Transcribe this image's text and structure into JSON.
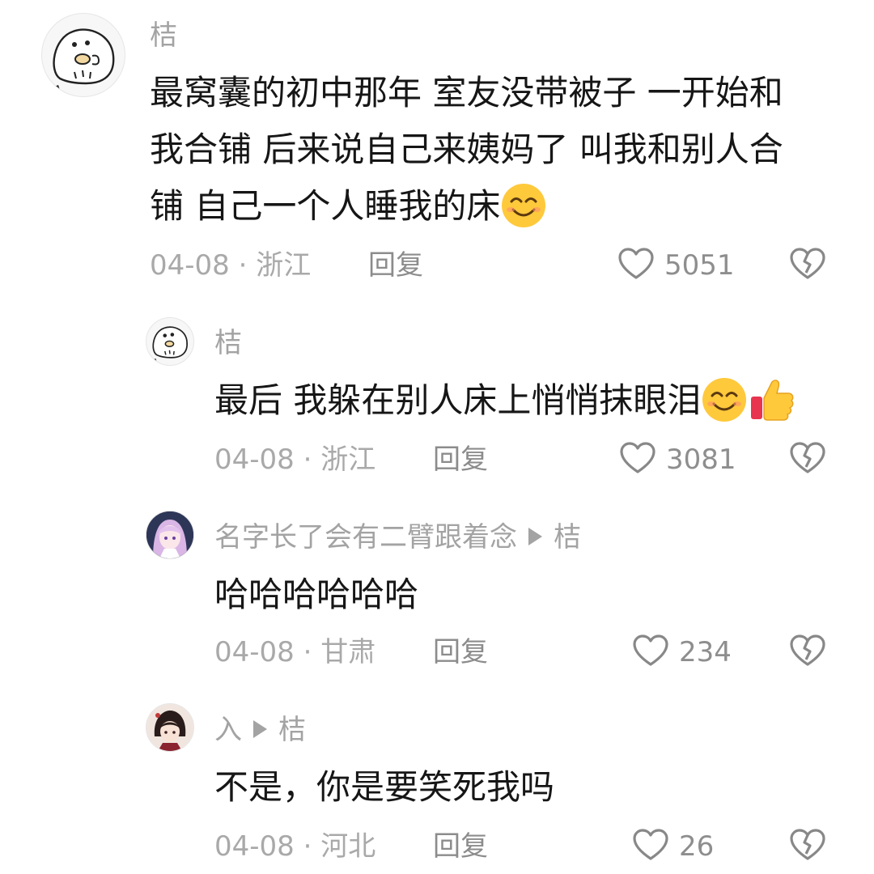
{
  "comments": [
    {
      "user": "桔",
      "lines": [
        "最窝囊的初中那年 室友没带被子 一开始和",
        "我合铺 后来说自己来姨妈了 叫我和别人合",
        "铺 自己一个人睡我的床"
      ],
      "date": "04-08",
      "location": "浙江",
      "reply_label": "回复",
      "likes": "5051"
    },
    {
      "user": "桔",
      "text": "最后 我躲在别人床上悄悄抹眼泪",
      "date": "04-08",
      "location": "浙江",
      "reply_label": "回复",
      "likes": "3081"
    },
    {
      "user": "名字长了会有二臂跟着念",
      "reply_to": "桔",
      "text": "哈哈哈哈哈哈",
      "date": "04-08",
      "location": "甘肃",
      "reply_label": "回复",
      "likes": "234"
    },
    {
      "user": "入",
      "reply_to": "桔",
      "text": "不是，你是要笑死我吗",
      "date": "04-08",
      "location": "河北",
      "reply_label": "回复",
      "likes": "26"
    }
  ],
  "separator": "·",
  "icons": {
    "like": "heart-outline-icon",
    "dislike": "broken-heart-icon",
    "smile": "smiling-face-emoji",
    "thumbs_up": "thumbs-up-emoji",
    "reply_arrow": "reply-arrow-icon"
  },
  "colors": {
    "text": "#161616",
    "muted": "#a3a3a3",
    "icon": "#888888",
    "emoji_yellow": "#ffc93c"
  }
}
